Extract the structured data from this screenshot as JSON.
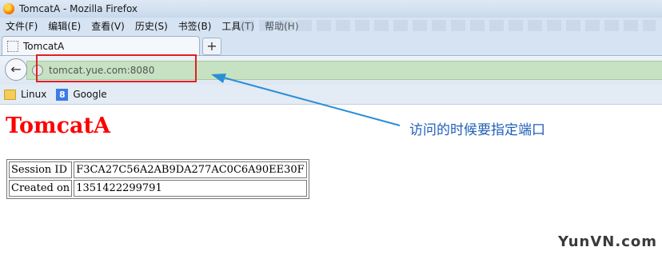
{
  "window": {
    "title": "TomcatA - Mozilla Firefox"
  },
  "menu": [
    "文件(F)",
    "编辑(E)",
    "查看(V)",
    "历史(S)",
    "书签(B)",
    "工具(T)",
    "帮助(H)"
  ],
  "tab": {
    "label": "TomcatA",
    "new_tab": "+"
  },
  "address": {
    "url": "tomcat.yue.com:8080"
  },
  "bookmarks": [
    {
      "label": "Linux",
      "icon": "folder-icon"
    },
    {
      "label": "Google",
      "icon": "google-icon"
    }
  ],
  "google_icon_glyph": "8",
  "page": {
    "heading": "TomcatA",
    "rows": [
      {
        "key": "Session ID",
        "value": "F3CA27C56A2AB9DA277AC0C6A90EE30F"
      },
      {
        "key": "Created on",
        "value": "1351422299791"
      }
    ]
  },
  "annotation": "访问的时候要指定端口",
  "watermark": "YunVN.com",
  "colors": {
    "heading": "#ff0000",
    "highlight": "#e02020",
    "arrow": "#2a8fd6",
    "urlbar": "#c6e2c2"
  }
}
